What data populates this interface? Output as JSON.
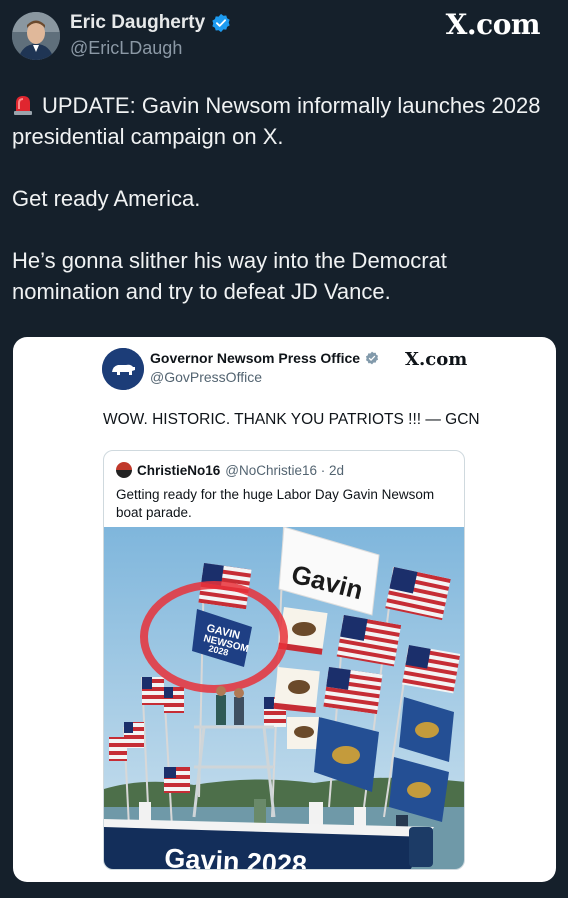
{
  "author": {
    "name": "Eric Daugherty",
    "handle": "@EricLDaugh"
  },
  "site_label": "X.com",
  "tweet": {
    "line1": "UPDATE: Gavin Newsom informally launches 2028 presidential campaign on X.",
    "line2": "Get ready America.",
    "line3": "He’s gonna slither his way into the Democrat nomination and try to defeat JD Vance."
  },
  "embedded": {
    "name": "Governor Newsom Press Office",
    "handle": "@GovPressOffice",
    "site_label": "X.com",
    "text": "WOW. HISTORIC. THANK YOU PATRIOTS !!! — GCN",
    "quote": {
      "name": "ChristieNo16",
      "meta": "@NoChristie16 · 2d",
      "text": "Getting ready for the huge Labor Day Gavin Newsom boat parade."
    },
    "image_text": {
      "flag_big": "Gavin",
      "sign_top": "GAVIN",
      "sign_mid": "NEWSOM",
      "sign_year": "2028",
      "boat": "Gavin 2028"
    }
  },
  "colors": {
    "background": "#15202b",
    "verified": "#1d9bf0",
    "red_circle": "#e8313a"
  },
  "icons": [
    "verified-badge-icon",
    "siren-icon",
    "bear-logo-icon"
  ]
}
